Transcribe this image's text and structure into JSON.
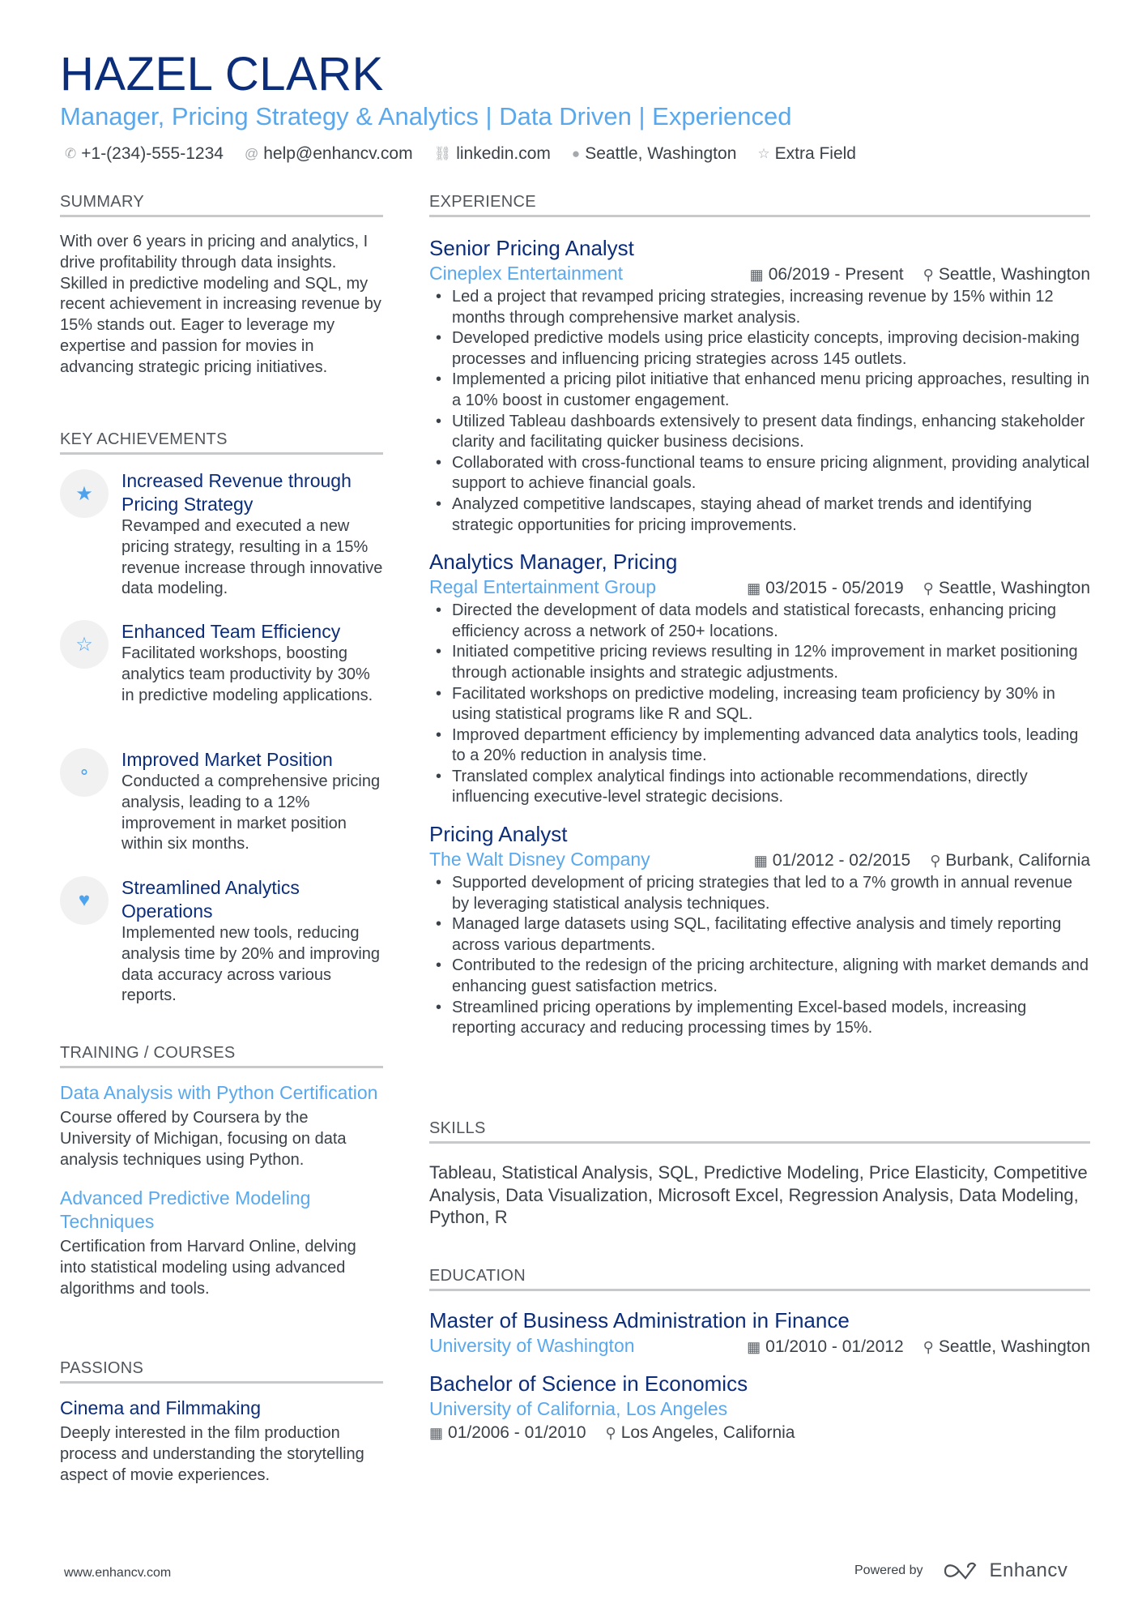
{
  "header": {
    "name": "HAZEL CLARK",
    "tagline": "Manager, Pricing Strategy & Analytics | Data Driven | Experienced",
    "contacts": [
      {
        "icon": "phone-icon",
        "glyph": "✆",
        "text": "+1-(234)-555-1234"
      },
      {
        "icon": "at-icon",
        "glyph": "@",
        "text": "help@enhancv.com"
      },
      {
        "icon": "link-icon",
        "glyph": "🔗",
        "text": "linkedin.com"
      },
      {
        "icon": "location-icon",
        "glyph": "⚲",
        "text": "Seattle, Washington"
      },
      {
        "icon": "star-outline-icon",
        "glyph": "☆",
        "text": "Extra Field"
      }
    ]
  },
  "summary": {
    "heading": "SUMMARY",
    "text": "With over 6 years in pricing and analytics, I drive profitability through data insights. Skilled in predictive modeling and SQL, my recent achievement in increasing revenue by 15% stands out. Eager to leverage my expertise and passion for movies in advancing strategic pricing initiatives."
  },
  "achievements": {
    "heading": "KEY ACHIEVEMENTS",
    "items": [
      {
        "icon": "star-filled-icon",
        "glyph": "★",
        "title": "Increased Revenue through Pricing Strategy",
        "desc": "Revamped and executed a new pricing strategy, resulting in a 15% revenue increase through innovative data modeling."
      },
      {
        "icon": "star-outline-icon",
        "glyph": "☆",
        "title": "Enhanced Team Efficiency",
        "desc": "Facilitated workshops, boosting analytics team productivity by 30% in predictive modeling applications."
      },
      {
        "icon": "lightbulb-icon",
        "glyph": "💡",
        "title": "Improved Market Position",
        "desc": "Conducted a comprehensive pricing analysis, leading to a 12% improvement in market position within six months."
      },
      {
        "icon": "heart-icon",
        "glyph": "♥",
        "title": "Streamlined Analytics Operations",
        "desc": "Implemented new tools, reducing analysis time by 20% and improving data accuracy across various reports."
      }
    ]
  },
  "training": {
    "heading": "TRAINING / COURSES",
    "items": [
      {
        "title": "Data Analysis with Python Certification",
        "desc": "Course offered by Coursera by the University of Michigan, focusing on data analysis techniques using Python."
      },
      {
        "title": "Advanced Predictive Modeling Techniques",
        "desc": "Certification from Harvard Online, delving into statistical modeling using advanced algorithms and tools."
      }
    ]
  },
  "passions": {
    "heading": "PASSIONS",
    "items": [
      {
        "title": "Cinema and Filmmaking",
        "desc": "Deeply interested in the film production process and understanding the storytelling aspect of movie experiences."
      }
    ]
  },
  "experience": {
    "heading": "EXPERIENCE",
    "jobs": [
      {
        "title": "Senior Pricing Analyst",
        "company": "Cineplex Entertainment",
        "dates": "06/2019 - Present",
        "location": "Seattle, Washington",
        "bullets": [
          "Led a project that revamped pricing strategies, increasing revenue by 15% within 12 months through comprehensive market analysis.",
          "Developed predictive models using price elasticity concepts, improving decision-making processes and influencing pricing strategies across 145 outlets.",
          "Implemented a pricing pilot initiative that enhanced menu pricing approaches, resulting in a 10% boost in customer engagement.",
          "Utilized Tableau dashboards extensively to present data findings, enhancing stakeholder clarity and facilitating quicker business decisions.",
          "Collaborated with cross-functional teams to ensure pricing alignment, providing analytical support to achieve financial goals.",
          "Analyzed competitive landscapes, staying ahead of market trends and identifying strategic opportunities for pricing improvements."
        ]
      },
      {
        "title": "Analytics Manager, Pricing",
        "company": "Regal Entertainment Group",
        "dates": "03/2015 - 05/2019",
        "location": "Seattle, Washington",
        "bullets": [
          "Directed the development of data models and statistical forecasts, enhancing pricing efficiency across a network of 250+ locations.",
          "Initiated competitive pricing reviews resulting in 12% improvement in market positioning through actionable insights and strategic adjustments.",
          "Facilitated workshops on predictive modeling, increasing team proficiency by 30% in using statistical programs like R and SQL.",
          "Improved department efficiency by implementing advanced data analytics tools, leading to a 20% reduction in analysis time.",
          "Translated complex analytical findings into actionable recommendations, directly influencing executive-level strategic decisions."
        ]
      },
      {
        "title": "Pricing Analyst",
        "company": "The Walt Disney Company",
        "dates": "01/2012 - 02/2015",
        "location": "Burbank, California",
        "bullets": [
          "Supported development of pricing strategies that led to a 7% growth in annual revenue by leveraging statistical analysis techniques.",
          "Managed large datasets using SQL, facilitating effective analysis and timely reporting across various departments.",
          "Contributed to the redesign of the pricing architecture, aligning with market demands and enhancing guest satisfaction metrics.",
          "Streamlined pricing operations by implementing Excel-based models, increasing reporting accuracy and reducing processing times by 15%."
        ]
      }
    ]
  },
  "skills": {
    "heading": "SKILLS",
    "text": "Tableau, Statistical Analysis, SQL, Predictive Modeling, Price Elasticity, Competitive Analysis, Data Visualization, Microsoft Excel, Regression Analysis, Data Modeling, Python, R"
  },
  "education": {
    "heading": "EDUCATION",
    "items": [
      {
        "degree": "Master of Business Administration in Finance",
        "school": "University of Washington",
        "dates": "01/2010 - 01/2012",
        "location": "Seattle, Washington"
      },
      {
        "degree": "Bachelor of Science in Economics",
        "school": "University of California, Los Angeles",
        "dates": "01/2006 - 01/2010",
        "location": "Los Angeles, California"
      }
    ]
  },
  "footer": {
    "website": "www.enhancv.com",
    "powered_by": "Powered by",
    "brand": "Enhancv"
  },
  "colors": {
    "name": "#0b2d7a",
    "accent": "#5aa8ec",
    "text": "#3a4148",
    "rule": "#c8c9cb"
  }
}
